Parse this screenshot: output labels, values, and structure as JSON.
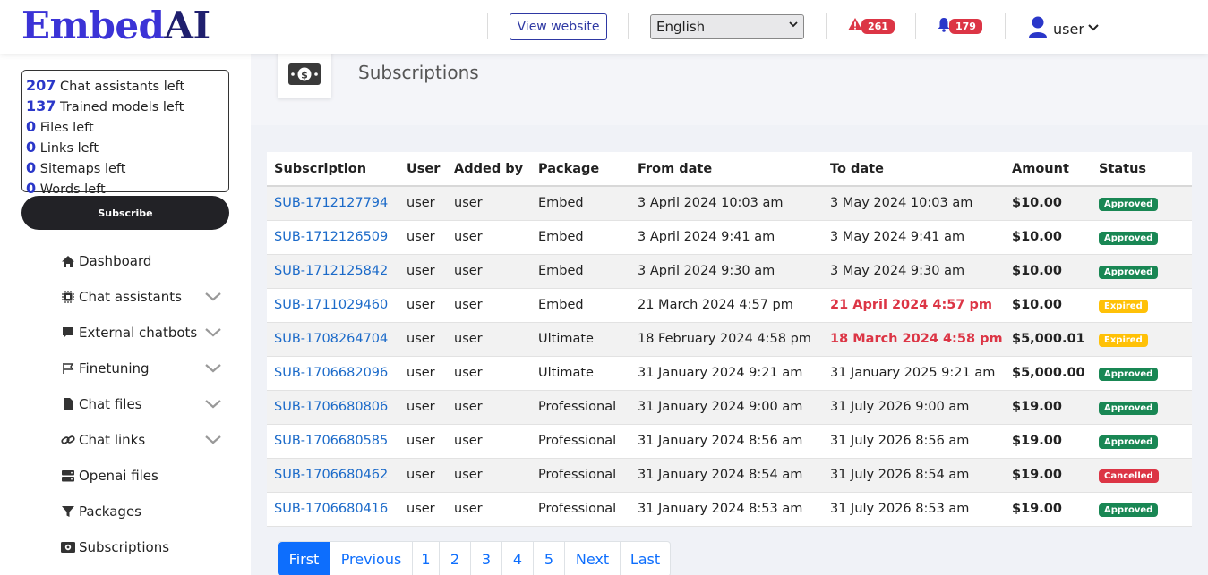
{
  "header": {
    "logo_part1": "Embed",
    "logo_part2": "AI",
    "view_website": "View website",
    "language": "English",
    "alerts_count": "261",
    "notifications_count": "179",
    "user_name": "user"
  },
  "quota": [
    {
      "num": "207",
      "label": "Chat assistants left"
    },
    {
      "num": "137",
      "label": "Trained models left"
    },
    {
      "num": "0",
      "label": "Files left"
    },
    {
      "num": "0",
      "label": "Links left"
    },
    {
      "num": "0",
      "label": "Sitemaps left"
    },
    {
      "num": "0",
      "label": "Words left"
    }
  ],
  "subscribe_label": "Subscribe",
  "nav": [
    {
      "label": "Dashboard",
      "icon": "home-icon",
      "chevron": false
    },
    {
      "label": "Chat assistants",
      "icon": "chip-icon",
      "chevron": true
    },
    {
      "label": "External chatbots",
      "icon": "chat-bubble-icon",
      "chevron": true
    },
    {
      "label": "Finetuning",
      "icon": "flag-icon",
      "chevron": true
    },
    {
      "label": "Chat files",
      "icon": "file-icon",
      "chevron": true
    },
    {
      "label": "Chat links",
      "icon": "link-icon",
      "chevron": true
    },
    {
      "label": "Openai files",
      "icon": "server-icon",
      "chevron": false
    },
    {
      "label": "Packages",
      "icon": "filter-icon",
      "chevron": false
    },
    {
      "label": "Subscriptions",
      "icon": "money-icon",
      "chevron": false
    }
  ],
  "page_title": "Subscriptions",
  "table": {
    "headers": [
      "Subscription",
      "User",
      "Added by",
      "Package",
      "From date",
      "To date",
      "Amount",
      "Status"
    ],
    "rows": [
      {
        "id": "SUB-1712127794",
        "user": "user",
        "added_by": "user",
        "package": "Embed",
        "from": "3 April 2024 10:03 am",
        "to": "3 May 2024 10:03 am",
        "amount": "$10.00",
        "status": "Approved",
        "to_expired": false
      },
      {
        "id": "SUB-1712126509",
        "user": "user",
        "added_by": "user",
        "package": "Embed",
        "from": "3 April 2024 9:41 am",
        "to": "3 May 2024 9:41 am",
        "amount": "$10.00",
        "status": "Approved",
        "to_expired": false
      },
      {
        "id": "SUB-1712125842",
        "user": "user",
        "added_by": "user",
        "package": "Embed",
        "from": "3 April 2024 9:30 am",
        "to": "3 May 2024 9:30 am",
        "amount": "$10.00",
        "status": "Approved",
        "to_expired": false
      },
      {
        "id": "SUB-1711029460",
        "user": "user",
        "added_by": "user",
        "package": "Embed",
        "from": "21 March 2024 4:57 pm",
        "to": "21 April 2024 4:57 pm",
        "amount": "$10.00",
        "status": "Expired",
        "to_expired": true
      },
      {
        "id": "SUB-1708264704",
        "user": "user",
        "added_by": "user",
        "package": "Ultimate",
        "from": "18 February 2024 4:58 pm",
        "to": "18 March 2024 4:58 pm",
        "amount": "$5,000.01",
        "status": "Expired",
        "to_expired": true
      },
      {
        "id": "SUB-1706682096",
        "user": "user",
        "added_by": "user",
        "package": "Ultimate",
        "from": "31 January 2024 9:21 am",
        "to": "31 January 2025 9:21 am",
        "amount": "$5,000.00",
        "status": "Approved",
        "to_expired": false
      },
      {
        "id": "SUB-1706680806",
        "user": "user",
        "added_by": "user",
        "package": "Professional",
        "from": "31 January 2024 9:00 am",
        "to": "31 July 2026 9:00 am",
        "amount": "$19.00",
        "status": "Approved",
        "to_expired": false
      },
      {
        "id": "SUB-1706680585",
        "user": "user",
        "added_by": "user",
        "package": "Professional",
        "from": "31 January 2024 8:56 am",
        "to": "31 July 2026 8:56 am",
        "amount": "$19.00",
        "status": "Approved",
        "to_expired": false
      },
      {
        "id": "SUB-1706680462",
        "user": "user",
        "added_by": "user",
        "package": "Professional",
        "from": "31 January 2024 8:54 am",
        "to": "31 July 2026 8:54 am",
        "amount": "$19.00",
        "status": "Cancelled",
        "to_expired": false
      },
      {
        "id": "SUB-1706680416",
        "user": "user",
        "added_by": "user",
        "package": "Professional",
        "from": "31 January 2024 8:53 am",
        "to": "31 July 2026 8:53 am",
        "amount": "$19.00",
        "status": "Approved",
        "to_expired": false
      }
    ]
  },
  "pagination": [
    "First",
    "Previous",
    "1",
    "2",
    "3",
    "4",
    "5",
    "Next",
    "Last"
  ],
  "colors": {
    "brand": "#3b33d6",
    "link": "#1b6ac9",
    "approved": "#198754",
    "expired": "#ffc107",
    "cancelled": "#dc3545",
    "primary": "#0d6efd"
  }
}
